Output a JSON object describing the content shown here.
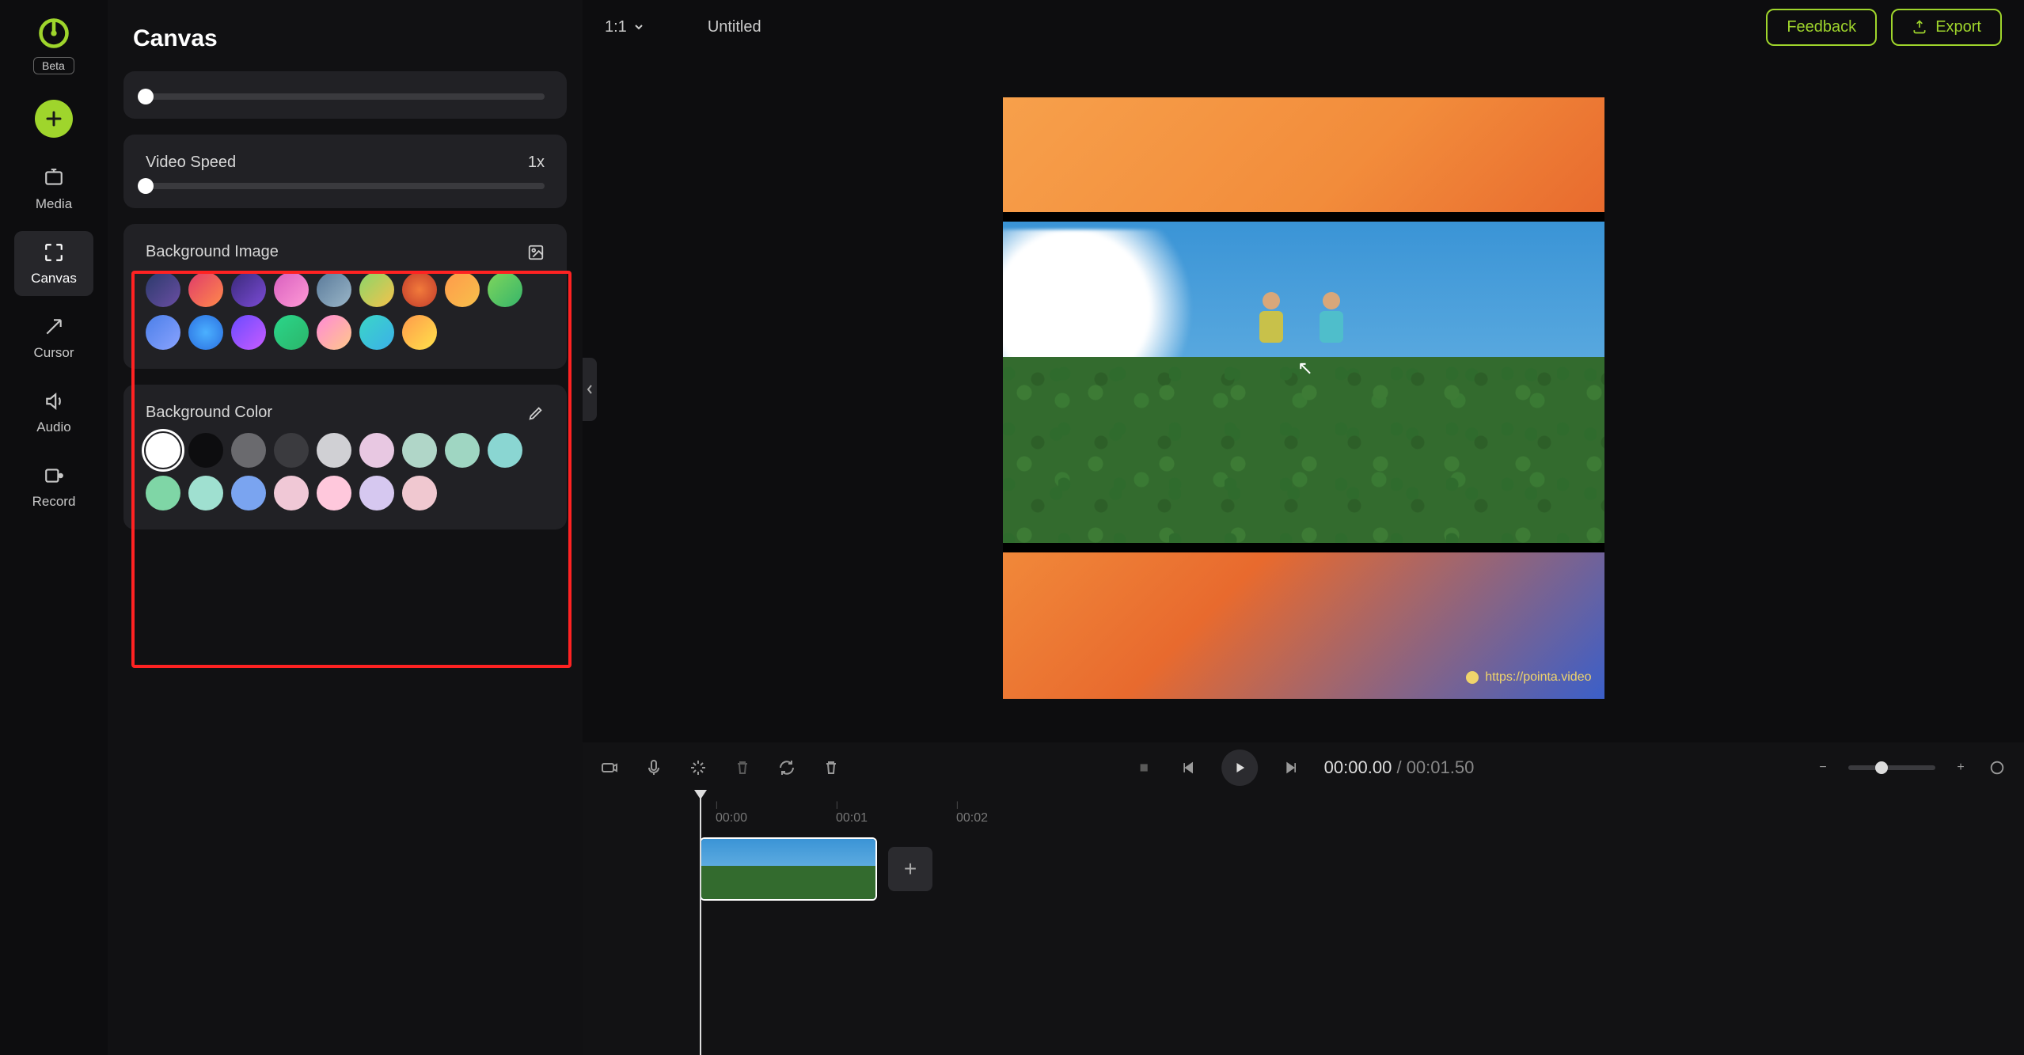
{
  "app": {
    "beta_label": "Beta"
  },
  "nav": {
    "items": [
      {
        "id": "media",
        "label": "Media"
      },
      {
        "id": "canvas",
        "label": "Canvas"
      },
      {
        "id": "cursor",
        "label": "Cursor"
      },
      {
        "id": "audio",
        "label": "Audio"
      },
      {
        "id": "record",
        "label": "Record"
      }
    ]
  },
  "panel": {
    "title": "Canvas",
    "video_speed": {
      "label": "Video Speed",
      "value": "1x"
    },
    "bg_image": {
      "label": "Background Image",
      "swatches": [
        "linear-gradient(135deg,#2b3a6b,#6a4ea3)",
        "linear-gradient(135deg,#e03b6a,#ff8a4b)",
        "linear-gradient(135deg,#3a2a7a,#7b4bd6)",
        "linear-gradient(135deg,#d85fbf,#ff9ad6)",
        "linear-gradient(135deg,#5a7a9a,#9ab6c8)",
        "linear-gradient(135deg,#8ad66a,#f5c24b)",
        "radial-gradient(circle,#f27b3b,#c23b2b)",
        "linear-gradient(135deg,#ff9a4b,#f7c04b)",
        "linear-gradient(135deg,#7fd65c,#36b56a)",
        "linear-gradient(135deg,#4b7fe8,#8aa3ff)",
        "radial-gradient(circle,#4bb0ff,#2b6fe0)",
        "linear-gradient(135deg,#6a4bff,#c85cff)",
        "linear-gradient(135deg,#2bd68a,#2bb56a)",
        "linear-gradient(135deg,#ff8ad6,#ffc88a)",
        "linear-gradient(135deg,#3bd6c8,#3bb0e8)",
        "linear-gradient(135deg,#ff9a4b,#ffe24b)"
      ]
    },
    "bg_color": {
      "label": "Background Color",
      "swatches": [
        "#ffffff",
        "#0d0d0f",
        "#6a6a6e",
        "#3b3b3f",
        "#d0d0d4",
        "#e8c8e2",
        "#b0d6c8",
        "#9fd6c2",
        "#8ad6d2",
        "#7fd6a6",
        "#9fe0d0",
        "#7aa4f0",
        "#f0c8d6",
        "#ffc8dc",
        "#d6c8f0",
        "#f0c8d0"
      ],
      "selected_index": 0
    }
  },
  "topbar": {
    "ratio": "1:1",
    "title": "Untitled",
    "feedback": "Feedback",
    "export": "Export"
  },
  "preview": {
    "watermark": "https://pointa.video"
  },
  "playback": {
    "current": "00:00.00",
    "separator": "/",
    "duration": "00:01.50"
  },
  "timeline": {
    "ticks": [
      "00:00",
      "00:01",
      "00:02"
    ]
  }
}
